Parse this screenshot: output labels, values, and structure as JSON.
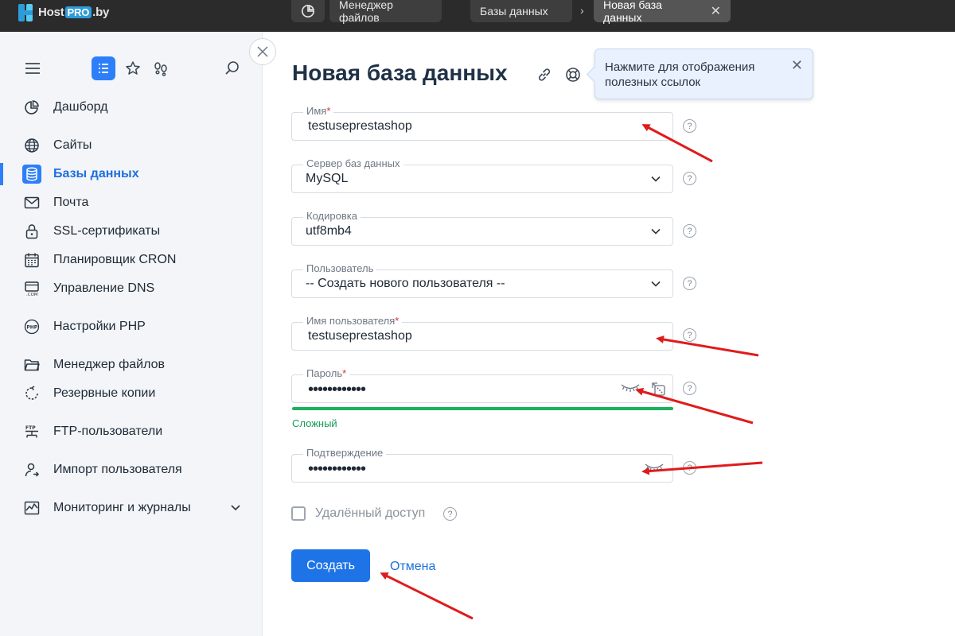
{
  "topbar": {
    "logo_host": "Host",
    "logo_pro": "PRO",
    "logo_tld": ".by",
    "breadcrumbs": [
      {
        "label": "Менеджер файлов"
      },
      {
        "label": "Базы данных"
      },
      {
        "label": "Новая база данных"
      }
    ]
  },
  "sidebar": {
    "items": [
      {
        "label": "Дашборд",
        "icon": "dashboard-icon"
      },
      {
        "label": "Сайты",
        "icon": "globe-icon"
      },
      {
        "label": "Базы данных",
        "icon": "database-icon"
      },
      {
        "label": "Почта",
        "icon": "mail-icon"
      },
      {
        "label": "SSL-сертификаты",
        "icon": "lock-icon"
      },
      {
        "label": "Планировщик CRON",
        "icon": "calendar-icon"
      },
      {
        "label": "Управление DNS",
        "icon": "dns-icon"
      },
      {
        "label": "Настройки PHP",
        "icon": "php-icon"
      },
      {
        "label": "Менеджер файлов",
        "icon": "folder-icon"
      },
      {
        "label": "Резервные копии",
        "icon": "backup-icon"
      },
      {
        "label": "FTP-пользователи",
        "icon": "ftp-icon"
      },
      {
        "label": "Импорт пользователя",
        "icon": "user-import-icon"
      },
      {
        "label": "Мониторинг и журналы",
        "icon": "monitoring-icon"
      }
    ],
    "active_item": "Базы данных"
  },
  "main": {
    "title": "Новая база данных",
    "tooltip": "Нажмите для отображения полезных ссылок",
    "fields": {
      "name": {
        "label": "Имя",
        "required": "*",
        "value": "testuseprestashop"
      },
      "server": {
        "label": "Сервер баз данных",
        "value": "MySQL"
      },
      "encoding": {
        "label": "Кодировка",
        "value": "utf8mb4"
      },
      "user": {
        "label": "Пользователь",
        "value": "-- Создать нового пользователя --"
      },
      "username": {
        "label": "Имя пользователя",
        "required": "*",
        "value": "testuseprestashop"
      },
      "password": {
        "label": "Пароль",
        "required": "*",
        "value": "••••••••••••",
        "strength": "Сложный"
      },
      "confirm": {
        "label": "Подтверждение",
        "value": "••••••••••••"
      }
    },
    "remote_access_label": "Удалённый доступ",
    "remote_access_checked": false,
    "help_symbol": "?",
    "create_label": "Создать",
    "cancel_label": "Отмена"
  },
  "colors": {
    "accent": "#1e74e6",
    "strength": "#1bb15e",
    "topbar": "#2b2b2b",
    "annotation_arrow": "#e01b1b"
  }
}
